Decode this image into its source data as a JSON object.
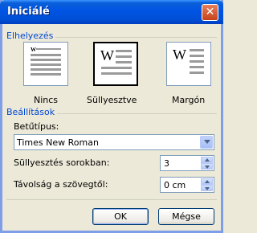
{
  "window": {
    "title": "Iniciálé",
    "close_glyph": "✕"
  },
  "placement": {
    "section_label": "Elhelyezés",
    "options": [
      {
        "label": "Nincs",
        "selected": false
      },
      {
        "label": "Süllyesztve",
        "selected": true
      },
      {
        "label": "Margón",
        "selected": false
      }
    ],
    "tile_letter": "W"
  },
  "settings": {
    "section_label": "Beállítások",
    "font_label": "Betűtípus:",
    "font_value": "Times New Roman",
    "lines_label": "Süllyesztés sorokban:",
    "lines_value": "3",
    "distance_label": "Távolság a szövegtől:",
    "distance_value": "0 cm"
  },
  "buttons": {
    "ok": "OK",
    "cancel": "Mégse"
  },
  "icons": {
    "close": "close-icon",
    "dropdown": "chevron-down-icon",
    "spin_up": "arrow-up-icon",
    "spin_down": "arrow-down-icon"
  },
  "colors": {
    "title_bar": "#0054e3",
    "section_label": "#0046d5",
    "dialog_bg": "#ece9d8"
  }
}
